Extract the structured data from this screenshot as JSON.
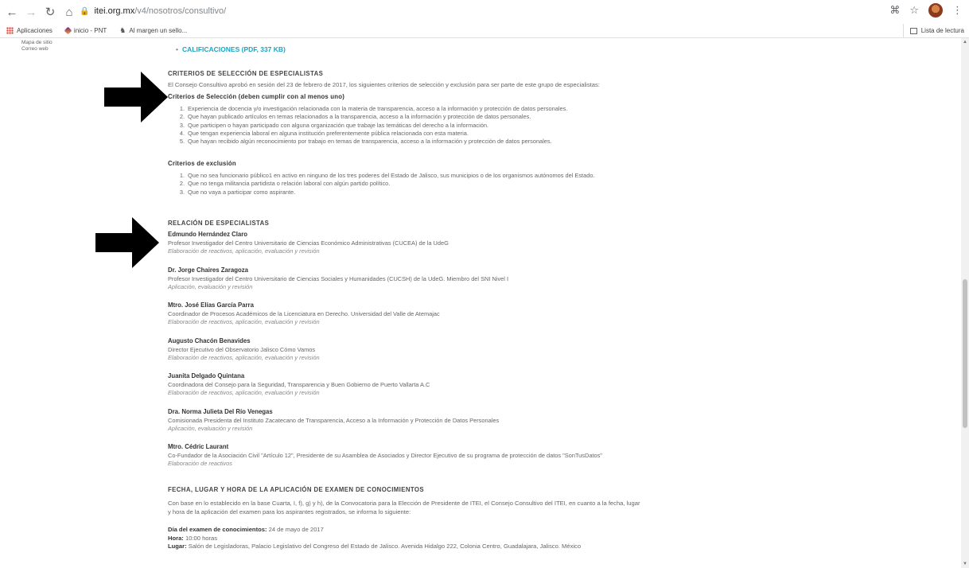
{
  "browser": {
    "url_host": "itei.org.mx",
    "url_path": "/v4/nosotros/consultivo/",
    "bookmarks": [
      "Aplicaciones",
      "inicio - PNT",
      "Al margen un sello..."
    ],
    "reading_list": "Lista de lectura"
  },
  "sidebar": {
    "links": [
      "Mapa de sitio",
      "Correo web"
    ]
  },
  "calificaciones_link": "CALIFICACIONES (PDF, 337 KB)",
  "criterios": {
    "title": "CRITERIOS DE SELECCIÓN DE ESPECIALISTAS",
    "intro": "El Consejo Consultivo aprobó en sesión del 23 de febrero de 2017, los siguientes criterios de selección y exclusión para ser parte de este grupo de especialistas:",
    "seleccion_title": "Criterios de Selección (deben cumplir con al menos uno)",
    "seleccion": [
      "Experiencia de docencia y/o investigación relacionada con la materia de transparencia, acceso a la información y protección de datos personales.",
      "Que hayan publicado artículos en temas relacionados a la transparencia, acceso a la información y protección de datos personales.",
      "Que participen o hayan participado con alguna organización que trabaje las temáticas del derecho a la información.",
      "Que tengan experiencia laboral en alguna institución preferentemente pública relacionada con esta materia.",
      "Que hayan recibido algún reconocimiento por trabajo en temas de transparencia, acceso a la información y protección de datos personales."
    ],
    "exclusion_title": "Criterios de exclusión",
    "exclusion": [
      "Que no sea funcionario público1 en activo en ninguno de los tres poderes del Estado de Jalisco, sus municipios o de los organismos autónomos del Estado.",
      "Que no tenga militancia partidista o relación laboral con algún partido político.",
      "Que no vaya a participar como aspirante."
    ]
  },
  "relacion": {
    "title": "RELACIÓN DE ESPECIALISTAS",
    "specialists": [
      {
        "name": "Edmundo Hernández Claro",
        "desc": "Profesor Investigador del Centro Universitario de Ciencias Económico Administrativas (CUCEA) de la UdeG",
        "role": "Elaboración de reactivos, aplicación, evaluación y revisión"
      },
      {
        "name": "Dr. Jorge Chaires Zaragoza",
        "desc": "Profesor Investigador del Centro Universitario de Ciencias Sociales y Humanidades (CUCSH) de la UdeG. Miembro del SNI Nivel I",
        "role": "Aplicación, evaluación y revisión"
      },
      {
        "name": "Mtro. José Elías García Parra",
        "desc": "Coordinador de Procesos Académicos de la Licenciatura en Derecho. Universidad del Valle de Atemajac",
        "role": "Elaboración de reactivos, aplicación, evaluación y revisión"
      },
      {
        "name": "Augusto Chacón Benavides",
        "desc": "Director Ejecutivo del Observatorio Jalisco Cómo Vamos",
        "role": "Elaboración de reactivos, aplicación, evaluación y revisión"
      },
      {
        "name": "Juanita Delgado Quintana",
        "desc": "Coordinadora del Consejo para la Seguridad, Transparencia y Buen Gobierno de Puerto Vallarta A.C",
        "role": "Elaboración de reactivos, aplicación, evaluación y revisión"
      },
      {
        "name": "Dra. Norma Julieta Del Río Venegas",
        "desc": "Comisionada Presidenta del Instituto Zacatecano de Transparencia, Acceso a la Información y Protección de Datos Personales",
        "role": "Aplicación, evaluación y revisión"
      },
      {
        "name": "Mtro. Cédric Laurant",
        "desc": "Co-Fundador de la Asociación Civil \"Artículo 12\", Presidente de su Asamblea de Asociados y Director Ejecutivo de su programa de protección de datos \"SonTusDatos\"",
        "role": "Elaboración de reactivos"
      }
    ]
  },
  "fecha": {
    "title": "FECHA, LUGAR Y HORA DE LA APLICACIÓN DE EXAMEN DE CONOCIMIENTOS",
    "p1": "Con base en lo establecido en la base Cuarta, I, f), g) y h), de la Convocatoria para la Elección de Presidente de ITEI, el Consejo Consultivo del ITEI, en cuanto a la fecha, lugar",
    "p2": "y hora de la aplicación del examen para los aspirantes registrados, se informa lo siguiente:",
    "dia_label": "Día del examen de conocimientos:",
    "dia_value": "24 de mayo de 2017",
    "hora_label": "Hora:",
    "hora_value": "10:00 horas",
    "lugar_label": "Lugar:",
    "lugar_value": "Salón de Legisladoras, Palacio Legislativo del Congreso del Estado de Jalisco. Avenida Hidalgo 222, Colonia Centro, Guadalajara, Jalisco. México"
  }
}
